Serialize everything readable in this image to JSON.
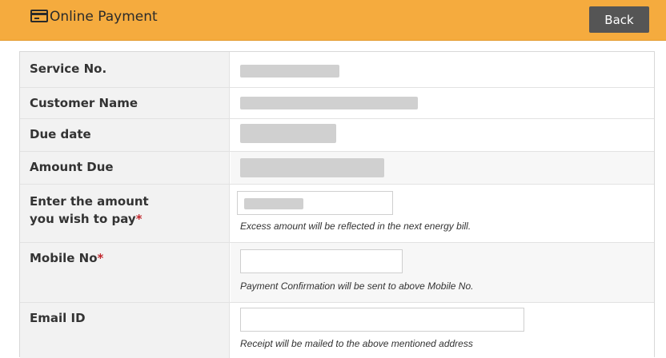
{
  "header": {
    "title": "Online Payment",
    "back_label": "Back",
    "icon": "credit-card-icon",
    "bg_color": "#f5ab3e"
  },
  "rows": {
    "service_no": {
      "label": "Service No."
    },
    "customer_name": {
      "label": "Customer Name"
    },
    "due_date": {
      "label": "Due date"
    },
    "amount_due": {
      "label": "Amount Due"
    },
    "amount_to_pay": {
      "label_line1": "Enter the amount",
      "label_line2": "you wish to pay",
      "required_mark": "*",
      "hint": "Excess amount will be reflected in the next energy bill."
    },
    "mobile_no": {
      "label": "Mobile No",
      "required_mark": "*",
      "hint": "Payment Confirmation will be sent to above Mobile No."
    },
    "email_id": {
      "label": "Email ID",
      "hint": "Receipt will be mailed to the above mentioned address"
    }
  }
}
